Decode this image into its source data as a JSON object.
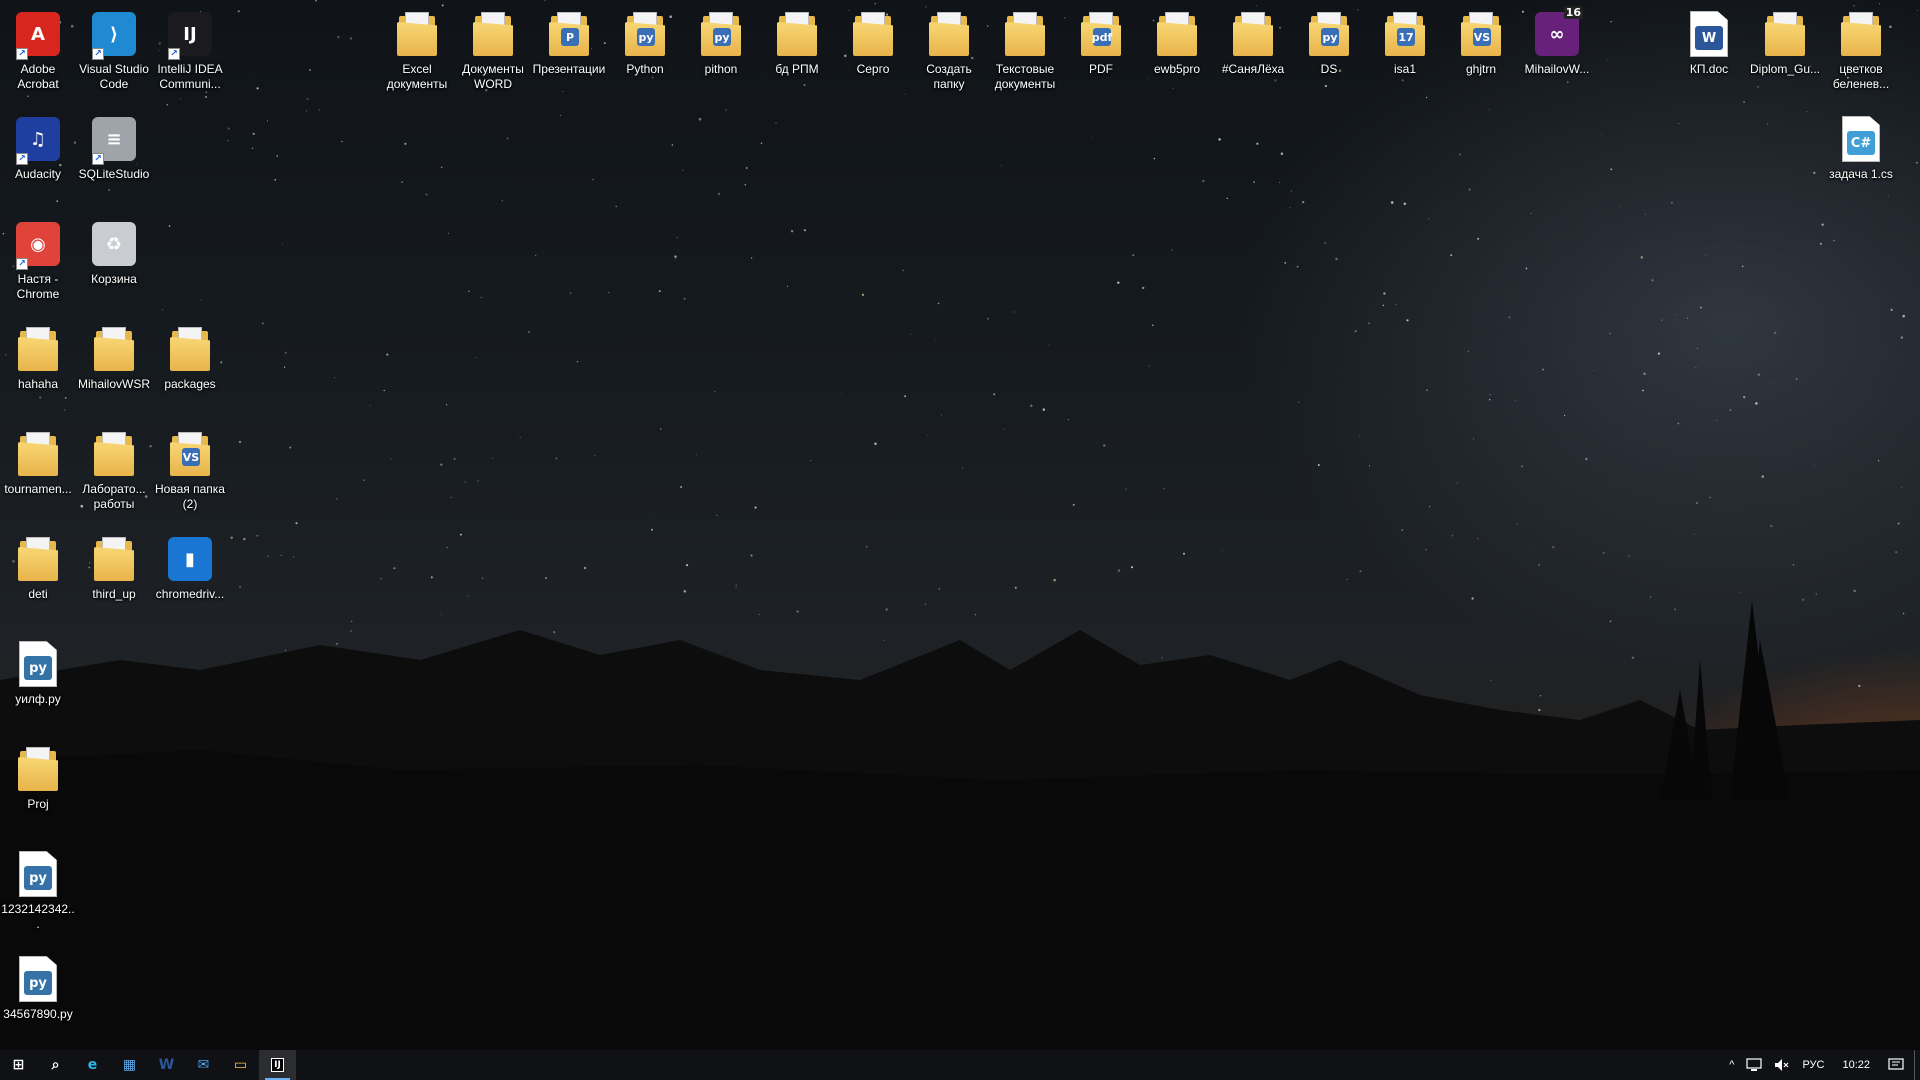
{
  "desktop": {
    "left_icons": [
      {
        "name": "adobe-acrobat",
        "label": "Adobe\nAcrobat",
        "kind": "app",
        "icon": "acrobat-icon",
        "color": "#d8261f",
        "glyph": "A",
        "shortcut": true
      },
      {
        "name": "visual-studio-code",
        "label": "Visual Studio\nCode",
        "kind": "app",
        "icon": "vscode-icon",
        "color": "#1f8ad2",
        "glyph": "⟩",
        "shortcut": true
      },
      {
        "name": "intellij-idea",
        "label": "IntelliJ IDEA\nCommuni...",
        "kind": "app",
        "icon": "intellij-icon",
        "color": "#1b1b1f",
        "glyph": "IJ",
        "shortcut": true
      },
      {
        "name": "audacity",
        "label": "Audacity",
        "kind": "app",
        "icon": "audacity-icon",
        "color": "#1e3fa0",
        "glyph": "♫",
        "shortcut": true
      },
      {
        "name": "sqlitestudio",
        "label": "SQLiteStudio",
        "kind": "app",
        "icon": "database-icon",
        "color": "#9ea4aa",
        "glyph": "≡",
        "shortcut": true
      },
      {
        "name": "chrome-nastya",
        "label": "Настя -\nChrome",
        "kind": "app",
        "icon": "chrome-icon",
        "color": "#e0433a",
        "glyph": "◉",
        "shortcut": true
      },
      {
        "name": "recycle-bin",
        "label": "Корзина",
        "kind": "app",
        "icon": "recycle-bin-icon",
        "color": "#c9ccd0",
        "glyph": "♻",
        "shortcut": false
      },
      {
        "name": "hahaha",
        "label": "hahaha",
        "kind": "folder",
        "icon": "folder-icon",
        "emblem": ""
      },
      {
        "name": "mihailovwsr",
        "label": "MihailovWSR",
        "kind": "folder",
        "icon": "folder-icon",
        "emblem": ""
      },
      {
        "name": "packages",
        "label": "packages",
        "kind": "folder",
        "icon": "folder-icon",
        "emblem": ""
      },
      {
        "name": "tournament",
        "label": "tournamen...",
        "kind": "folder",
        "icon": "folder-icon",
        "emblem": ""
      },
      {
        "name": "labs",
        "label": "Лаборато...\nработы",
        "kind": "folder",
        "icon": "folder-icon",
        "emblem": ""
      },
      {
        "name": "new-folder-2",
        "label": "Новая папка\n(2)",
        "kind": "folder",
        "icon": "folder-icon",
        "emblem": "VS"
      },
      {
        "name": "deti",
        "label": "deti",
        "kind": "folder",
        "icon": "folder-icon",
        "emblem": ""
      },
      {
        "name": "third-up",
        "label": "third_up",
        "kind": "folder",
        "icon": "folder-icon",
        "emblem": ""
      },
      {
        "name": "chromedriver",
        "label": "chromedriv...",
        "kind": "app",
        "icon": "exe-icon",
        "color": "#1976d2",
        "glyph": "▮",
        "shortcut": false
      },
      {
        "name": "uilf-py",
        "label": "уилф.py",
        "kind": "doc",
        "icon": "python-file-icon",
        "color": "#3572a5",
        "glyph": "py"
      },
      {
        "name": "proj",
        "label": "Proj",
        "kind": "folder",
        "icon": "folder-icon",
        "emblem": ""
      },
      {
        "name": "py-1232142342",
        "label": "1232142342...",
        "kind": "doc",
        "icon": "python-file-icon",
        "color": "#3572a5",
        "glyph": "py"
      },
      {
        "name": "py-34567890",
        "label": "34567890.py",
        "kind": "doc",
        "icon": "python-file-icon",
        "color": "#3572a5",
        "glyph": "py"
      }
    ],
    "top_icons": [
      {
        "name": "excel-docs",
        "label": "Excel\nдокументы",
        "kind": "folder",
        "icon": "folder-icon",
        "emblem": ""
      },
      {
        "name": "word-docs",
        "label": "Документы\nWORD",
        "kind": "folder",
        "icon": "folder-icon",
        "emblem": ""
      },
      {
        "name": "presentations",
        "label": "Презентации",
        "kind": "folder",
        "icon": "folder-icon",
        "emblem": "P"
      },
      {
        "name": "python-folder",
        "label": "Python",
        "kind": "folder",
        "icon": "folder-icon",
        "emblem": "py"
      },
      {
        "name": "pithon-folder",
        "label": "pithon",
        "kind": "folder",
        "icon": "folder-icon",
        "emblem": "py"
      },
      {
        "name": "bd-rpm",
        "label": "бд РПМ",
        "kind": "folder",
        "icon": "folder-icon",
        "emblem": ""
      },
      {
        "name": "sergo",
        "label": "Серго",
        "kind": "folder",
        "icon": "folder-icon",
        "emblem": ""
      },
      {
        "name": "create-folder",
        "label": "Создать\nпапку",
        "kind": "folder",
        "icon": "folder-icon",
        "emblem": ""
      },
      {
        "name": "text-docs",
        "label": "Текстовые\nдокументы",
        "kind": "folder",
        "icon": "folder-icon",
        "emblem": ""
      },
      {
        "name": "pdf-folder",
        "label": "PDF",
        "kind": "folder",
        "icon": "folder-icon",
        "emblem": "pdf"
      },
      {
        "name": "ewb5pro",
        "label": "ewb5pro",
        "kind": "folder",
        "icon": "folder-icon",
        "emblem": ""
      },
      {
        "name": "sanya-lyokha",
        "label": "#СаняЛёха",
        "kind": "folder",
        "icon": "folder-icon",
        "emblem": ""
      },
      {
        "name": "ds",
        "label": "DS",
        "kind": "folder",
        "icon": "folder-icon",
        "emblem": "py"
      },
      {
        "name": "isa1",
        "label": "isa1",
        "kind": "folder",
        "icon": "folder-icon",
        "emblem": "17"
      },
      {
        "name": "ghjtrn",
        "label": "ghjtrn",
        "kind": "folder",
        "icon": "folder-icon",
        "emblem": "VS"
      },
      {
        "name": "mihailovw-sln",
        "label": "MihailovW...",
        "kind": "app",
        "icon": "visual-studio-icon",
        "color": "#68217a",
        "glyph": "∞",
        "shortcut": false,
        "badge": "16"
      }
    ],
    "right_icons": [
      {
        "name": "kp-doc",
        "label": "КП.doc",
        "kind": "doc",
        "icon": "word-file-icon",
        "color": "#2b579a",
        "glyph": "W"
      },
      {
        "name": "diplom-gu",
        "label": "Diplom_Gu...",
        "kind": "folder",
        "icon": "folder-icon",
        "emblem": ""
      },
      {
        "name": "tsvetkov-belenev",
        "label": "цветков\nбеленев...",
        "kind": "folder",
        "icon": "folder-icon",
        "emblem": ""
      },
      {
        "name": "zadacha-1-cs",
        "label": "задача 1.cs",
        "kind": "doc",
        "icon": "csharp-file-icon",
        "color": "#3f9fd6",
        "glyph": "C#"
      }
    ]
  },
  "taskbar": {
    "buttons": [
      {
        "name": "start-button",
        "icon": "windows-icon",
        "glyph": "⊞",
        "color": "#ffffff",
        "active": false
      },
      {
        "name": "search-button",
        "icon": "search-icon",
        "glyph": "⌕",
        "color": "#ffffff",
        "active": false
      },
      {
        "name": "taskbar-edge",
        "icon": "edge-icon",
        "glyph": "e",
        "color": "#2fb6e6",
        "active": false
      },
      {
        "name": "taskbar-store",
        "icon": "store-icon",
        "glyph": "▦",
        "color": "#5aa9e6",
        "active": false
      },
      {
        "name": "taskbar-word",
        "icon": "word-icon",
        "glyph": "W",
        "color": "#2b579a",
        "active": false
      },
      {
        "name": "taskbar-mail",
        "icon": "mail-icon",
        "glyph": "✉",
        "color": "#4aa3f0",
        "active": false
      },
      {
        "name": "taskbar-explorer",
        "icon": "file-explorer-icon",
        "glyph": "▭",
        "color": "#f2c94c",
        "active": false
      },
      {
        "name": "taskbar-intellij",
        "icon": "intellij-icon",
        "glyph": "IJ",
        "color": "#ffffff",
        "active": true
      }
    ],
    "tray": {
      "chevron": "^",
      "network_icon": "network-icon",
      "volume_icon": "volume-muted-icon",
      "language": "РУС",
      "time": "10:22",
      "notification_icon": "notification-icon"
    }
  }
}
